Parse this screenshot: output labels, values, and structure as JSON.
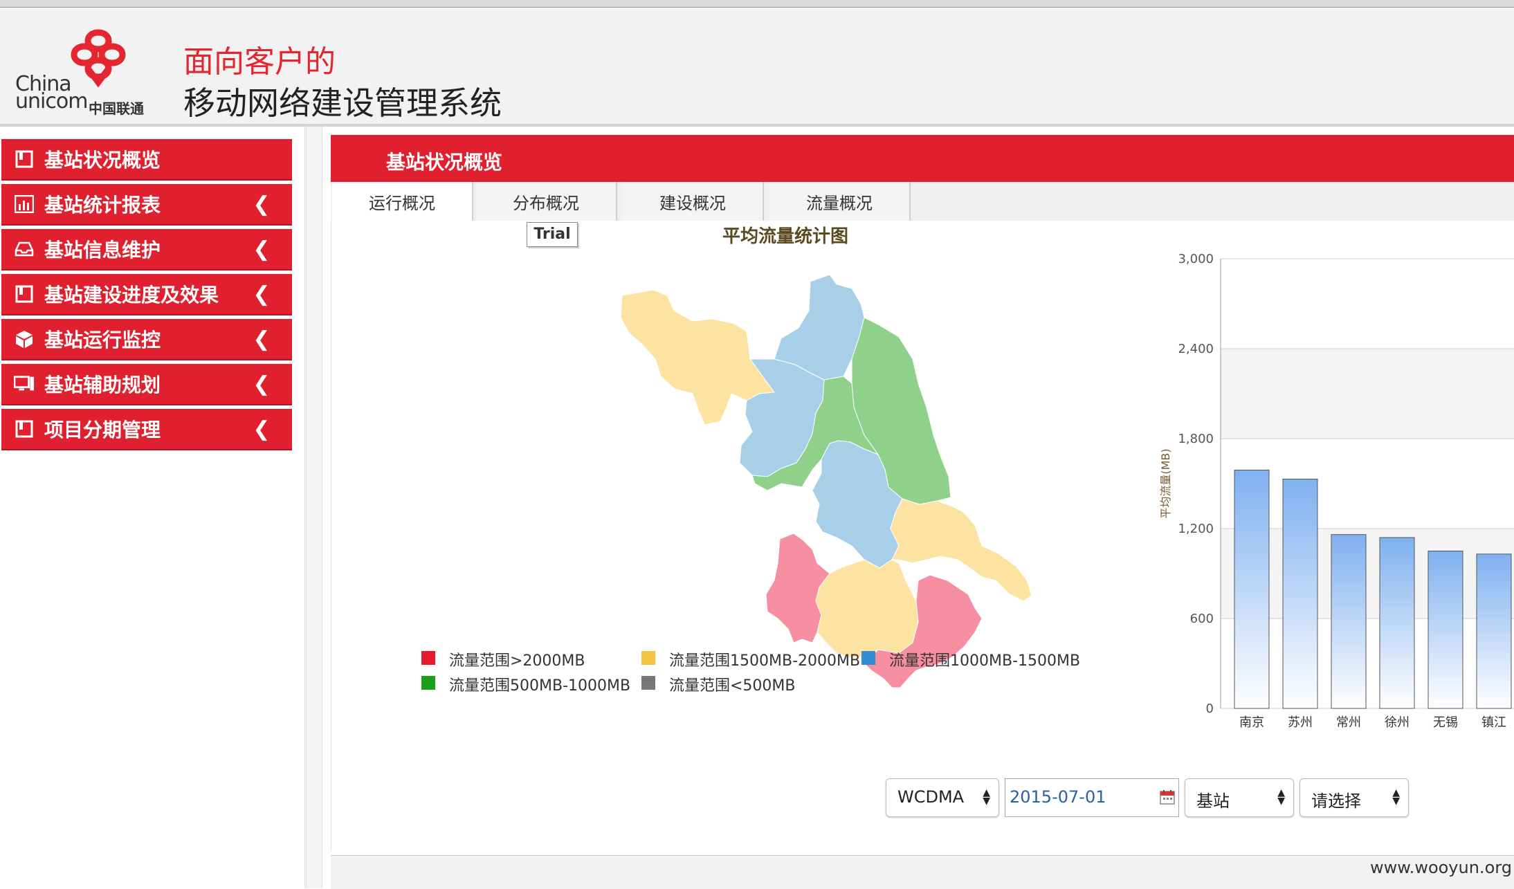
{
  "header": {
    "logo_text_line1": "China",
    "logo_text_line2": "unicom",
    "logo_text_cn": "中国联通",
    "title_line1": "面向客户的",
    "title_line2": "移动网络建设管理系统"
  },
  "sidebar": {
    "items": [
      {
        "label": "基站状况概览",
        "icon": "square-icon",
        "has_chevron": false
      },
      {
        "label": "基站统计报表",
        "icon": "bar-chart-icon",
        "has_chevron": true
      },
      {
        "label": "基站信息维护",
        "icon": "inbox-icon",
        "has_chevron": true
      },
      {
        "label": "基站建设进度及效果",
        "icon": "square-icon",
        "has_chevron": true
      },
      {
        "label": "基站运行监控",
        "icon": "cube-icon",
        "has_chevron": true
      },
      {
        "label": "基站辅助规划",
        "icon": "monitor-icon",
        "has_chevron": true
      },
      {
        "label": "项目分期管理",
        "icon": "square-icon",
        "has_chevron": true
      }
    ],
    "chevron": "❮"
  },
  "main": {
    "header_title": "基站状况概览",
    "tabs": [
      {
        "label": "运行概况",
        "active": true
      },
      {
        "label": "分布概况",
        "active": false
      },
      {
        "label": "建设概况",
        "active": false
      },
      {
        "label": "流量概况",
        "active": false
      }
    ],
    "trial_label": "Trial",
    "map_title": "平均流量统计图",
    "legend": [
      {
        "label": "流量范围>2000MB",
        "color": "#e8192c"
      },
      {
        "label": "流量范围1500MB-2000MB",
        "color": "#f4c542"
      },
      {
        "label": "流量范围1000MB-1500MB",
        "color": "#2f8fd0"
      },
      {
        "label": "流量范围500MB-1000MB",
        "color": "#1aa01a"
      },
      {
        "label": "流量范围<500MB",
        "color": "#777777"
      }
    ],
    "map_colors": {
      "pink": "#f78fa3",
      "yellow": "#fde3a1",
      "blue": "#a8cfe8",
      "green": "#8fd18b"
    }
  },
  "controls": {
    "network_select": "WCDMA",
    "date_value": "2015-07-01",
    "type_select": "基站",
    "choose_select": "请选择"
  },
  "chart_data": {
    "type": "bar",
    "title": "",
    "ylabel": "平均流量(MB)",
    "xlabel": "",
    "categories": [
      "南京",
      "苏州",
      "常州",
      "徐州",
      "无锡",
      "镇江"
    ],
    "values": [
      1590,
      1530,
      1160,
      1140,
      1050,
      1030
    ],
    "ylim": [
      0,
      3000
    ],
    "yticks": [
      "0",
      "600",
      "1,200",
      "1,800",
      "2,400",
      "3,000"
    ],
    "grid": true
  },
  "footer": {
    "watermark": "www.wooyun.org"
  }
}
